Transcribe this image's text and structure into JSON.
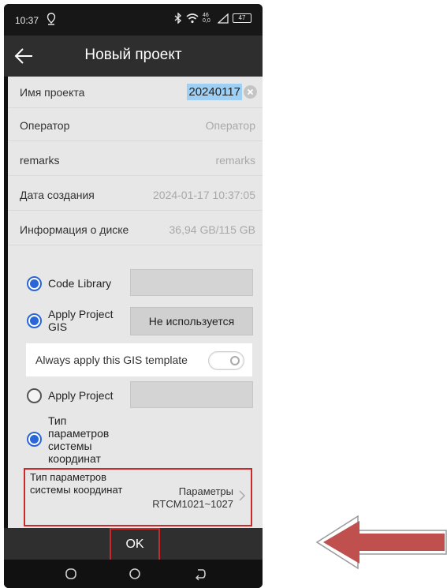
{
  "status_bar": {
    "time": "10:37",
    "signal_label": "46 0,0",
    "battery_level": "47"
  },
  "header": {
    "title": "Новый проект"
  },
  "fields": [
    {
      "label": "Имя проекта",
      "value": "20240117"
    },
    {
      "label": "Оператор",
      "value": "Оператор"
    },
    {
      "label": "remarks",
      "value": "remarks"
    },
    {
      "label": "Дата создания",
      "value": "2024-01-17 10:37:05"
    },
    {
      "label": "Информация о диске",
      "value": "36,94 GB/115 GB"
    }
  ],
  "options": {
    "code_library": {
      "label": "Code Library",
      "selected": true
    },
    "apply_project_gis": {
      "label": "Apply Project GIS",
      "selected": true,
      "button_label": "Не используется"
    },
    "gis_template": {
      "label": "Always apply this GIS template",
      "enabled": false
    },
    "apply_project": {
      "label": "Apply Project",
      "selected": false
    },
    "coord_type_option": {
      "label": "Тип параметров системы координат",
      "selected": true
    }
  },
  "coord_row": {
    "label": "Тип параметров системы координат",
    "value": "Параметры RTCM1021~1027"
  },
  "ok_button": {
    "label": "OK"
  },
  "colors": {
    "accent": "#2a66d8",
    "highlight_box": "#cc2a2a",
    "selection": "#9fd0f4",
    "arrow": "#c0504d"
  }
}
